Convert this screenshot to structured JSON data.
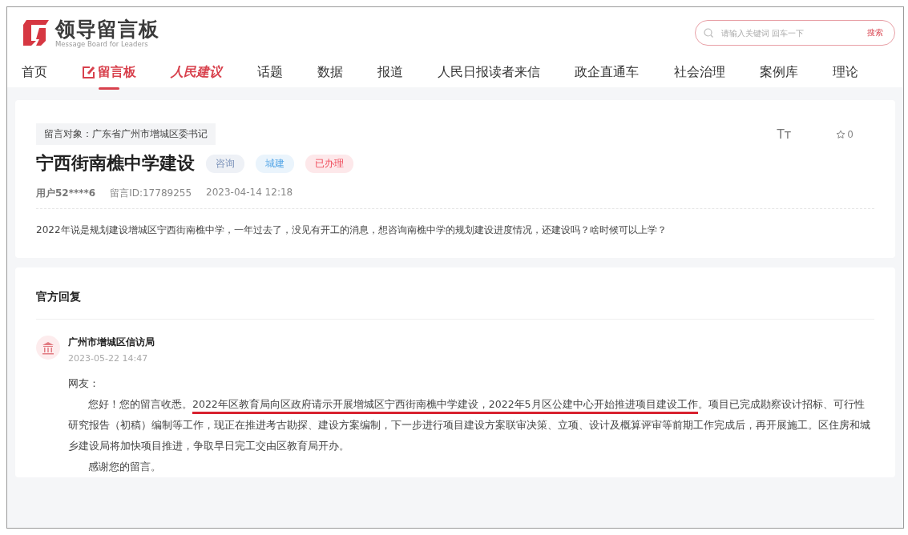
{
  "header": {
    "logo": {
      "title": "领导留言板",
      "subtitle": "Message Board for Leaders"
    },
    "search": {
      "placeholder": "请输入关键词 回车一下",
      "button": "搜索"
    }
  },
  "nav": [
    {
      "label": "首页",
      "kind": "text",
      "selected": false
    },
    {
      "label": "留言板",
      "kind": "icon-text",
      "selected": true
    },
    {
      "label": "人民建议",
      "kind": "brand",
      "selected": false
    },
    {
      "label": "话题",
      "kind": "text",
      "selected": false
    },
    {
      "label": "数据",
      "kind": "text",
      "selected": false
    },
    {
      "label": "报道",
      "kind": "text",
      "selected": false
    },
    {
      "label": "人民日报读者来信",
      "kind": "text",
      "selected": false
    },
    {
      "label": "政企直通车",
      "kind": "text",
      "selected": false
    },
    {
      "label": "社会治理",
      "kind": "text",
      "selected": false
    },
    {
      "label": "案例库",
      "kind": "text",
      "selected": false
    },
    {
      "label": "理论",
      "kind": "text",
      "selected": false
    }
  ],
  "message": {
    "recipient": "留言对象：广东省广州市增城区委书记",
    "font_size": "Tт",
    "favorites": "0",
    "title": "宁西街南樵中学建设",
    "tags": [
      {
        "label": "咨询",
        "color": "#eef1f6"
      },
      {
        "label": "城建",
        "color": "#eaf4fc"
      },
      {
        "label": "已办理",
        "color": "#fde8ea"
      }
    ],
    "user": "用户52****6",
    "id": "留言ID:17789255",
    "time": "2023-04-14 12:18",
    "body": "2022年说是规划建设增城区宁西街南樵中学，一年过去了，没见有开工的消息，想咨询南樵中学的规划建设进度情况，还建设吗？啥时候可以上学？"
  },
  "reply": {
    "heading": "官方回复",
    "org": "广州市增城区信访局",
    "time": "2023-05-22 14:47",
    "greeting": "网友：",
    "paragraphs": [
      {
        "parts": [
          {
            "text": "您好！您的留言收悉。",
            "underlined": false
          },
          {
            "text": "2022年区教育局向区政府请示开展增城区宁西街南樵中学建设，2022年5月区公建中心开始推进项目建设工作",
            "underlined": true
          },
          {
            "text": "。项目已完成勘察设计招标、可行性研究报告（初稿）编制等工作，现正在推进考古勘探、建设方案编制，下一步进行项目建设方案联审决策、立项、设计及概算评审等前期工作完成后，再开展施工。区住房和城乡建设局将加快项目推进，争取早日完工交由区教育局开办。",
            "underlined": false
          }
        ]
      },
      {
        "parts": [
          {
            "text": "感谢您的留言。",
            "underlined": false
          }
        ]
      }
    ]
  }
}
